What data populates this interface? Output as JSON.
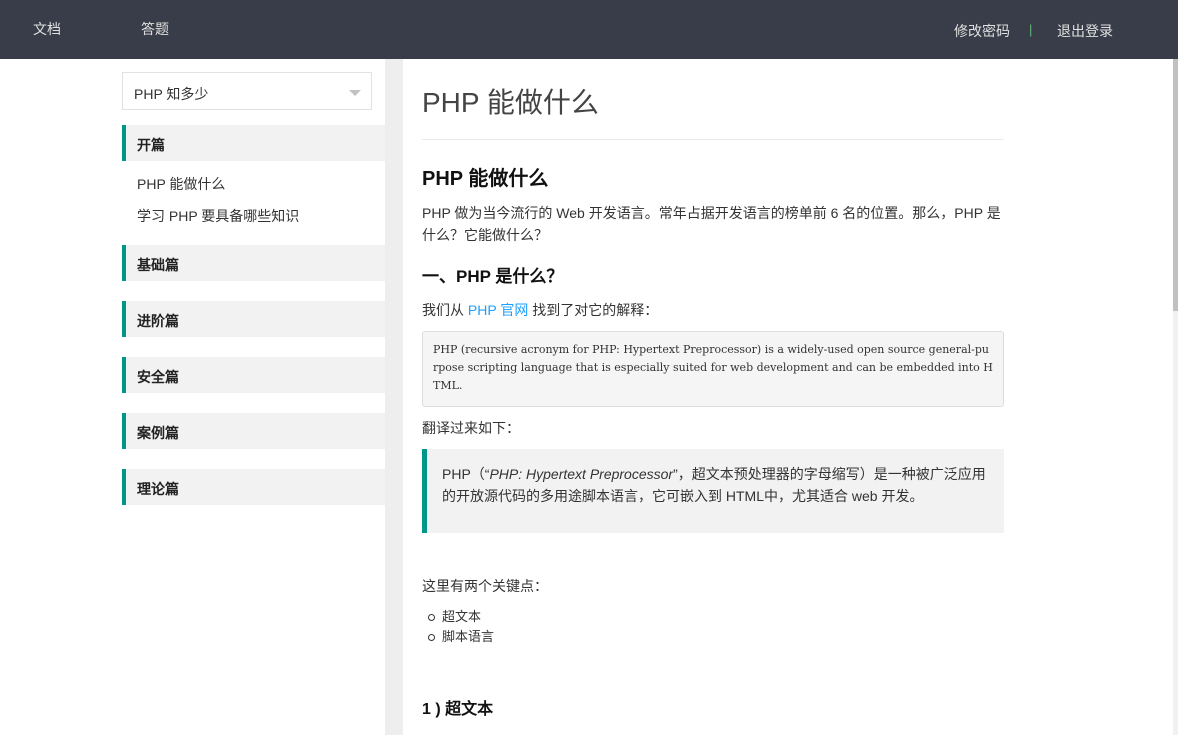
{
  "topnav": {
    "docs": "文档",
    "qa": "答题",
    "change_password": "修改密码",
    "separator": "|",
    "logout": "退出登录"
  },
  "sidebar": {
    "select_value": "PHP 知多少",
    "sections": [
      {
        "title": "开篇",
        "items": [
          "PHP 能做什么",
          "学习 PHP 要具备哪些知识"
        ]
      },
      {
        "title": "基础篇",
        "items": []
      },
      {
        "title": "进阶篇",
        "items": []
      },
      {
        "title": "安全篇",
        "items": []
      },
      {
        "title": "案例篇",
        "items": []
      },
      {
        "title": "理论篇",
        "items": []
      }
    ]
  },
  "article": {
    "page_title": "PHP 能做什么",
    "heading": "PHP 能做什么",
    "intro": "PHP 做为当今流行的 Web 开发语言。常年占据开发语言的榜单前 6 名的位置。那么，PHP 是什么？它能做什么？",
    "section1_title": "一、PHP 是什么？",
    "from_prefix": "我们从 ",
    "from_link": "PHP 官网",
    "from_suffix": " 找到了对它的解释：",
    "code": "PHP (recursive acronym for PHP: Hypertext Preprocessor) is a widely-used open source general-purpose scripting language that is especially suited for web development and can be embedded into HTML.",
    "translate_label": "翻译过来如下：",
    "quote_pre": "PHP（“",
    "quote_em": "PHP: Hypertext Preprocessor",
    "quote_post": "”，超文本预处理器的字母缩写）是一种被广泛应用的开放源代码的多用途脚本语言，它可嵌入到 HTML中，尤其适合 web 开发。",
    "keypoints_label": "这里有两个关键点：",
    "keypoints": [
      "超文本",
      "脚本语言"
    ],
    "subsection1_title": "1 ) 超文本"
  },
  "colors": {
    "topbar": "#393d49",
    "accent": "#009688",
    "link": "#1e9fff"
  }
}
